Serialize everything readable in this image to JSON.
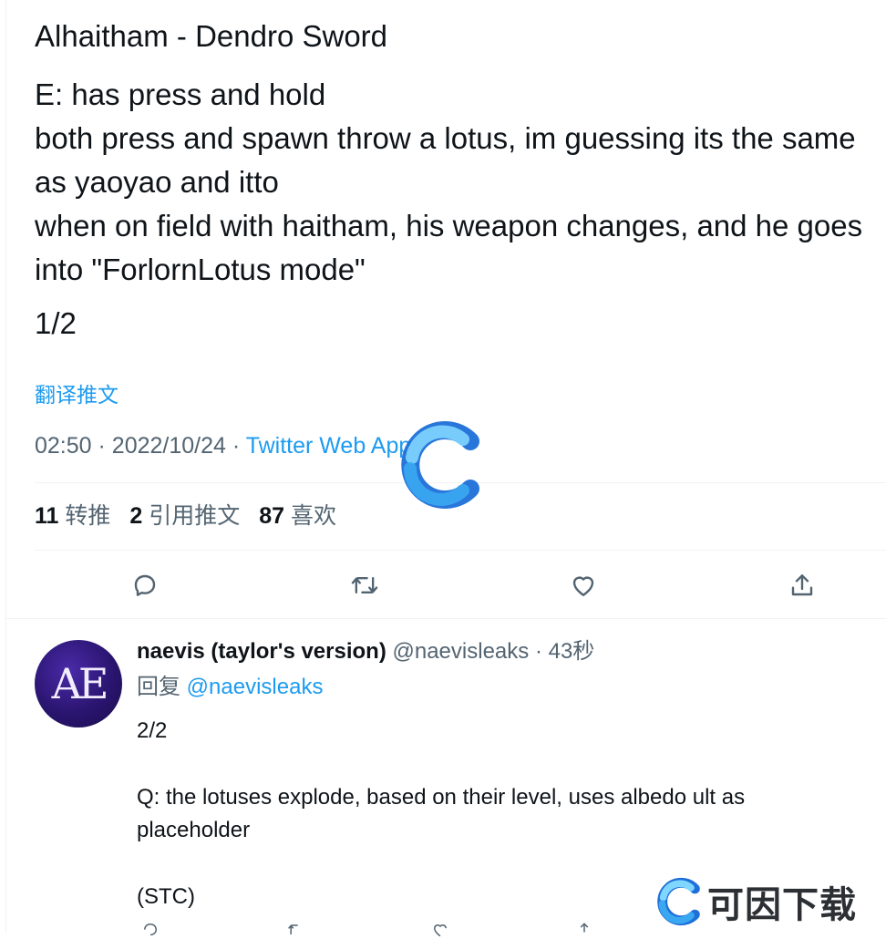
{
  "tweet": {
    "title": "Alhaitham - Dendro Sword",
    "lines": [
      "E: has press and hold",
      "both press and spawn throw a lotus, im guessing its the same as yaoyao and itto",
      "when on field with haitham, his weapon changes, and he goes into \"ForlornLotus mode\""
    ],
    "page": "1/2",
    "translate_link": "翻译推文",
    "time": "02:50",
    "date": "2022/10/24",
    "separator": "·",
    "client": "Twitter Web App",
    "stats": {
      "retweets_count": "11",
      "retweets_label": "转推",
      "quotes_count": "2",
      "quotes_label": "引用推文",
      "likes_count": "87",
      "likes_label": "喜欢"
    },
    "actions": [
      "reply-icon",
      "retweet-icon",
      "like-icon",
      "share-icon"
    ]
  },
  "reply": {
    "avatar_text": "AE",
    "display_name": "naevis (taylor's version)",
    "handle": "@naevisleaks",
    "time_ago": "· 43秒",
    "replying_label": "回复",
    "replying_to": "@naevisleaks",
    "lines": [
      "2/2",
      "Q: the lotuses explode, based on their level, uses albedo ult as placeholder",
      "(STC)"
    ]
  },
  "watermark": {
    "brand": "可因下载",
    "colors": {
      "light_blue": "#4fc3f7",
      "dark_blue": "#1e6fd9"
    }
  },
  "colors": {
    "accent": "#1d9bf0",
    "muted": "#536471",
    "text": "#0f1419",
    "divider": "#eff3f4"
  }
}
